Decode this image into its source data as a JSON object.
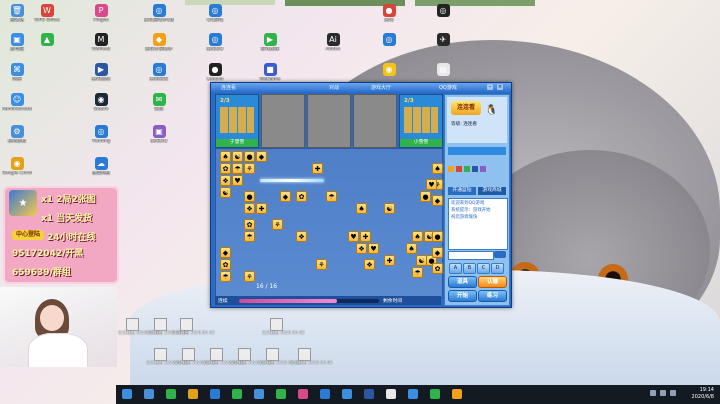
{
  "desktop_icons": [
    {
      "label": "回收站",
      "col": 0,
      "row": 0,
      "color": "#4a90d9",
      "glyph": "🗑"
    },
    {
      "label": "WPS Office",
      "col": 1,
      "row": 0,
      "color": "#d9443a",
      "glyph": "W"
    },
    {
      "label": "Pingko",
      "col": 2,
      "row": 0,
      "color": "#d84a8a",
      "glyph": "P"
    },
    {
      "label": "腾讯游戏手机版",
      "col": 3,
      "row": 0,
      "color": "#2a7bd3",
      "glyph": "◎"
    },
    {
      "label": "此电脑",
      "col": 0,
      "row": 1,
      "color": "#3b8ee0",
      "glyph": "▣"
    },
    {
      "label": "",
      "col": 1,
      "row": 1,
      "color": "#2fb34a",
      "glyph": "▲"
    },
    {
      "label": "WeMeet",
      "col": 2,
      "row": 1,
      "color": "#222222",
      "glyph": "M"
    },
    {
      "label": "腾讯手游助手",
      "col": 3,
      "row": 1,
      "color": "#f2a21a",
      "glyph": "◆"
    },
    {
      "label": "网络",
      "col": 0,
      "row": 2,
      "color": "#3b8ee0",
      "glyph": "⌘"
    },
    {
      "label": "腾讯视频",
      "col": 2,
      "row": 2,
      "color": "#2a57a0",
      "glyph": "▶"
    },
    {
      "label": "腾讯管家",
      "col": 3,
      "row": 2,
      "color": "#2a7bd3",
      "glyph": "◎"
    },
    {
      "label": "Administrator",
      "col": 0,
      "row": 3,
      "color": "#3b8ee0",
      "glyph": "☺"
    },
    {
      "label": "Steam",
      "col": 2,
      "row": 3,
      "color": "#1b2838",
      "glyph": "◉"
    },
    {
      "label": "微信",
      "col": 3,
      "row": 3,
      "color": "#2fb34a",
      "glyph": "✉"
    },
    {
      "label": "控制面板",
      "col": 0,
      "row": 4,
      "color": "#4a90d9",
      "glyph": "⚙"
    },
    {
      "label": "Tianting",
      "col": 2,
      "row": 4,
      "color": "#2a7bd3",
      "glyph": "◎"
    },
    {
      "label": "腾讯QQ",
      "col": 3,
      "row": 4,
      "color": "#8a5cc4",
      "glyph": "▣"
    },
    {
      "label": "Google Chrome",
      "col": 0,
      "row": 5,
      "color": "#e0a21a",
      "glyph": "◉"
    },
    {
      "label": "百度网盘",
      "col": 2,
      "row": 5,
      "color": "#2a7bd3",
      "glyph": "☁"
    },
    {
      "label": "QQ游戏",
      "col": 4,
      "row": 0,
      "color": "#2a7bd3",
      "glyph": "◎"
    },
    {
      "label": "腾讯QQ",
      "col": 4,
      "row": 1,
      "color": "#2a7bd3",
      "glyph": "◎"
    },
    {
      "label": "Lenovo",
      "col": 4,
      "row": 2,
      "color": "#222222",
      "glyph": "●"
    },
    {
      "label": "游戏加速",
      "col": 5,
      "row": 1,
      "color": "#2fb34a",
      "glyph": "▶"
    },
    {
      "label": "WeGame",
      "col": 5,
      "row": 2,
      "color": "#3b5bd3",
      "glyph": "■"
    },
    {
      "label": "Adobe",
      "col": 7,
      "row": 1,
      "color": "#2a2a2a",
      "glyph": "Ai"
    },
    {
      "label": "腾讯",
      "col": 8,
      "row": 0,
      "color": "#d9443a",
      "glyph": "●"
    },
    {
      "label": "",
      "col": 8,
      "row": 1,
      "color": "#2a7bd3",
      "glyph": "◎"
    },
    {
      "label": "",
      "col": 8,
      "row": 2,
      "color": "#f2c41a",
      "glyph": "◉"
    },
    {
      "label": "",
      "col": 9,
      "row": 0,
      "color": "#222222",
      "glyph": "◎"
    },
    {
      "label": "",
      "col": 9,
      "row": 1,
      "color": "#2a2a2a",
      "glyph": "✈"
    },
    {
      "label": "",
      "col": 9,
      "row": 2,
      "color": "#e8e8e8",
      "glyph": "▤"
    }
  ],
  "promo": {
    "line1": "x1 2局2张图",
    "line2": "x1 当天发货",
    "tag": "中心登陆",
    "line3": "24小时在线",
    "line4": "95172042/开黑",
    "line5": "659639/群组"
  },
  "game": {
    "title": "QQ游戏",
    "tabs": [
      "连连看",
      "对战",
      "游戏大厅"
    ],
    "player_left": {
      "name": "于慧雪",
      "score": "2/3"
    },
    "player_right": {
      "name": "小雪雪",
      "score": "2/3"
    },
    "progress_label": "剩余",
    "progress_value": "16 / 16",
    "progress_fraction": 0.7,
    "bottom_left": "连续",
    "bottom_right": "剩余时间",
    "sidebar": {
      "logo": "连连看",
      "rank": "等级: 连连看",
      "tab_a": "开通蓝钻",
      "tab_b": "游戏商城",
      "messages": [
        "欢迎来到QQ游戏",
        "系统提示：游戏开始",
        "祝您游戏愉快"
      ],
      "btn_start": "开始",
      "btn_exercise": "练习",
      "btn_prop": "道具",
      "btn_give": "认输",
      "small_buttons": [
        "A",
        "B",
        "C",
        "D"
      ]
    }
  },
  "shortcuts": [
    {
      "label": "宝贝截图 2020-06-08"
    },
    {
      "label": "宝贝截图 2020-06-08"
    },
    {
      "label": "宝贝截图 2020-06-08"
    },
    {
      "label": "宝贝截图 2020-06-08"
    },
    {
      "label": "宝贝截图 2020-06-08"
    },
    {
      "label": "宝贝截图 2020-06-08"
    },
    {
      "label": "宝贝截图 2020-06-08"
    },
    {
      "label": "宝贝截图 2020-06-08"
    },
    {
      "label": "宝贝截图 2020-06-08"
    },
    {
      "label": "宝贝截图 2020-06-08"
    }
  ],
  "taskbar": {
    "apps": [
      "#3b8ee0",
      "#4a90d9",
      "#2fb34a",
      "#e0a21a",
      "#2a7bd3",
      "#2fb34a",
      "#4a90d9",
      "#2fb34a",
      "#d84a8a",
      "#2a7bd3",
      "#3b8ee0",
      "#2a57a0",
      "#e8e8e8",
      "#3b8ee0",
      "#2fb34a",
      "#f2a21a"
    ],
    "time": "19:14",
    "date": "2020/6/8"
  }
}
